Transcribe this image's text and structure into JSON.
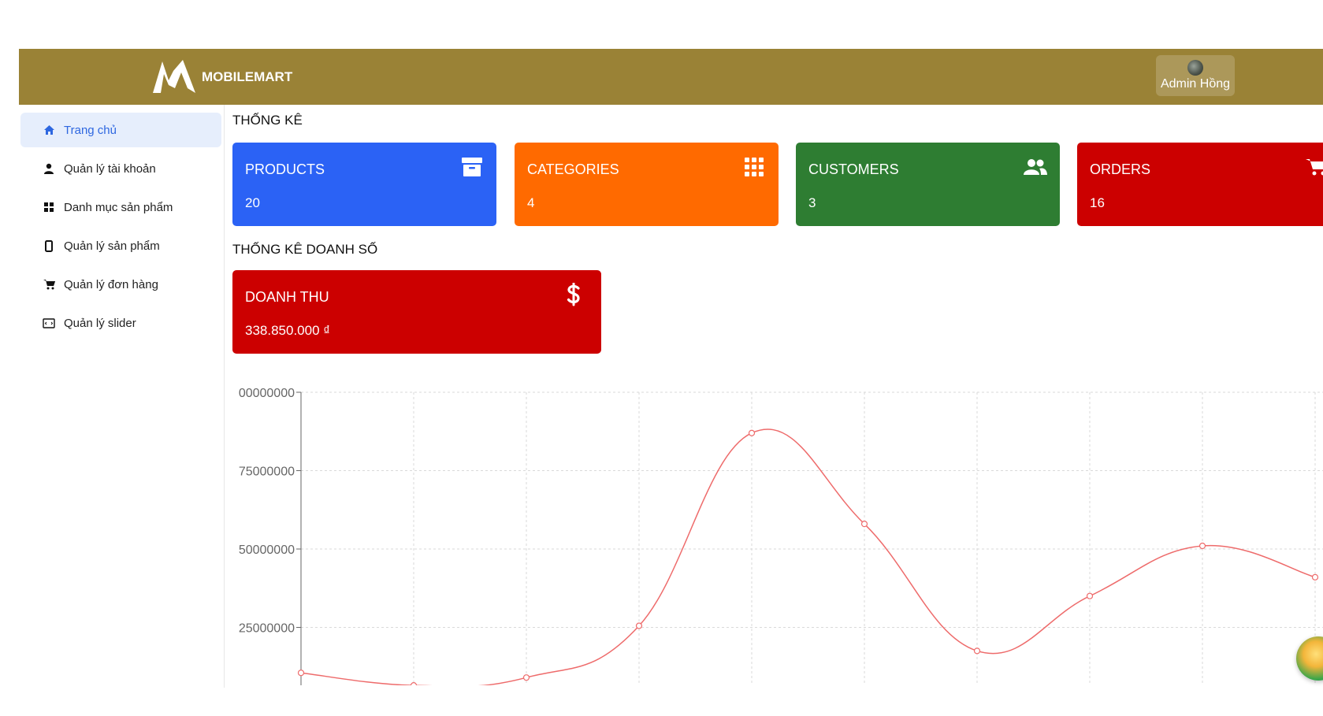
{
  "header": {
    "brand": "MOBILEMART",
    "user_name": "Admin Hồng",
    "background": "#9a8236"
  },
  "sidebar": {
    "items": [
      {
        "label": "Trang chủ",
        "icon": "home-icon",
        "active": true
      },
      {
        "label": "Quản lý tài khoản",
        "icon": "user-icon"
      },
      {
        "label": "Danh mục sản phẩm",
        "icon": "grid-icon"
      },
      {
        "label": "Quản lý sản phẩm",
        "icon": "mobile-icon"
      },
      {
        "label": "Quản lý đơn hàng",
        "icon": "cart-icon"
      },
      {
        "label": "Quản lý slider",
        "icon": "slider-icon"
      }
    ],
    "active_color": "#2e67e0"
  },
  "stats": {
    "title": "THỐNG KÊ",
    "cards": [
      {
        "title": "PRODUCTS",
        "value": "20",
        "icon": "archive-icon",
        "color": "#2b62f5"
      },
      {
        "title": "CATEGORIES",
        "value": "4",
        "icon": "grid-icon",
        "color": "#ff6a00"
      },
      {
        "title": "CUSTOMERS",
        "value": "3",
        "icon": "users-icon",
        "color": "#2e7d32"
      },
      {
        "title": "ORDERS",
        "value": "16",
        "icon": "cart-icon",
        "color": "#cc0000"
      }
    ]
  },
  "sales": {
    "title": "THỐNG KÊ DOANH SỐ",
    "revenue_title": "DOANH THU",
    "revenue_value": "338.850.000 ₫",
    "revenue_icon": "dollar-icon",
    "color": "#cc0000"
  },
  "chart_data": {
    "type": "line",
    "title": "",
    "xlabel": "",
    "ylabel": "",
    "ylim": [
      0,
      100000000
    ],
    "y_tick_labels": [
      "00000000",
      "75000000",
      "50000000",
      "25000000"
    ],
    "grid": true,
    "series": [
      {
        "values": [
          10500000,
          6500000,
          9000000,
          25500000,
          87000000,
          58000000,
          17500000,
          35000000,
          51000000,
          41000000
        ],
        "color": "#ee6b6b"
      }
    ]
  }
}
